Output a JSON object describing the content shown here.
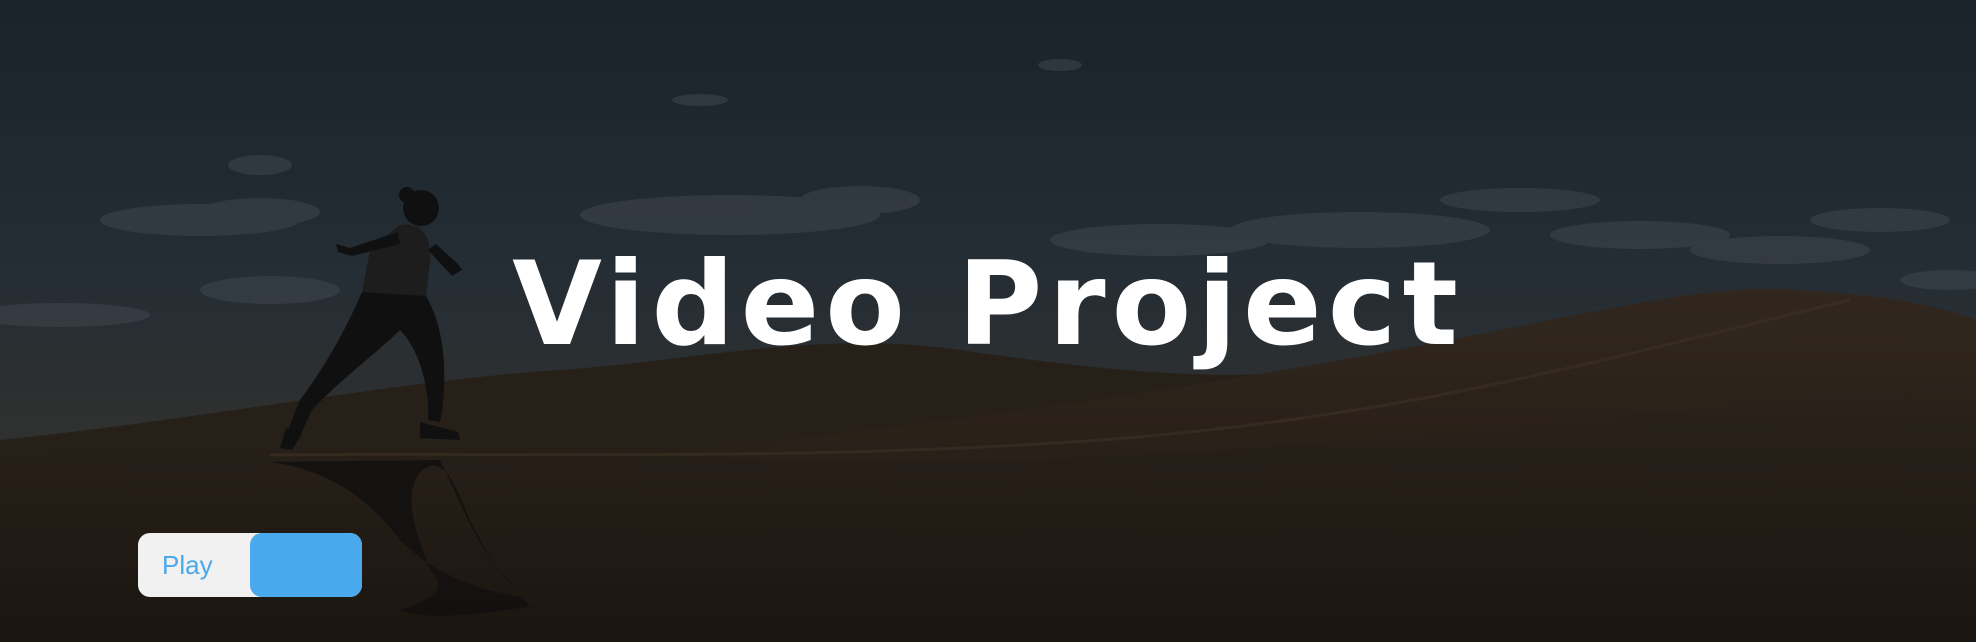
{
  "hero": {
    "title": "Video Project",
    "background": "desert-runner-photo"
  },
  "play_toggle": {
    "label": "Play",
    "accent_color": "#4aa8ec",
    "track_color": "#f1f1f1"
  }
}
